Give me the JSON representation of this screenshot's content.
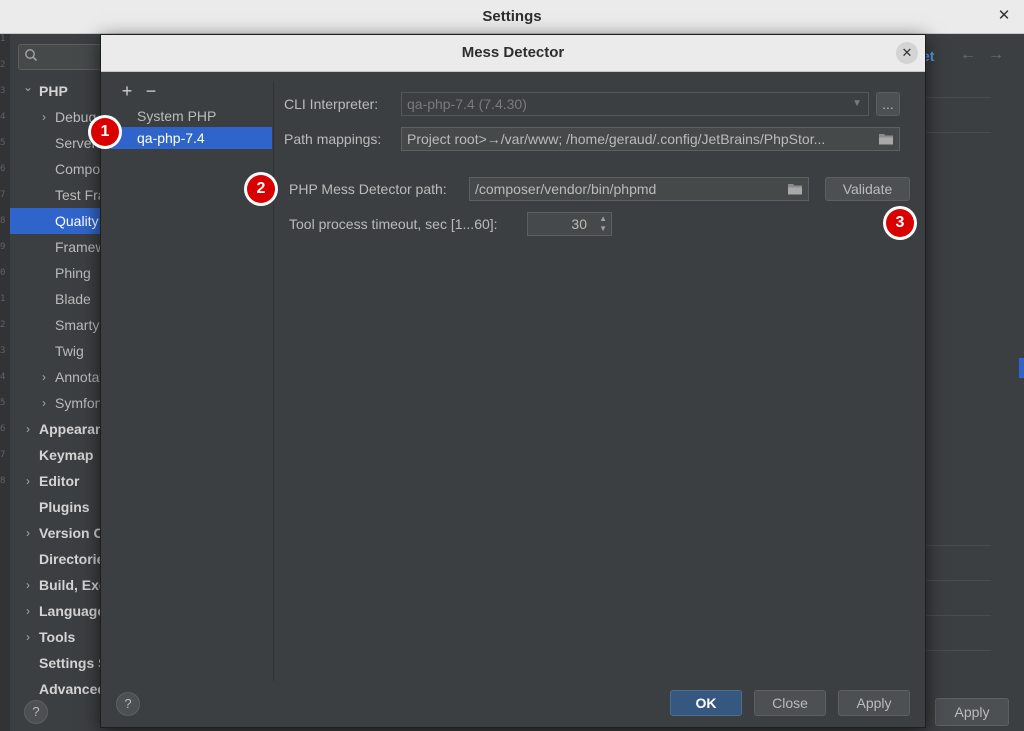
{
  "settings": {
    "title": "Settings",
    "close_icon": "close-icon",
    "search": {
      "value": "",
      "icon": "search-icon"
    },
    "tree": [
      {
        "label": "PHP",
        "level": 0,
        "bold": true,
        "chevron": "down"
      },
      {
        "label": "Debug",
        "level": 1,
        "bold": false,
        "chevron": "right"
      },
      {
        "label": "Servers",
        "level": 1,
        "bold": false,
        "chevron": ""
      },
      {
        "label": "Composer",
        "level": 1,
        "bold": false,
        "chevron": ""
      },
      {
        "label": "Test Frameworks",
        "level": 1,
        "bold": false,
        "chevron": ""
      },
      {
        "label": "Quality Tools",
        "level": 1,
        "bold": false,
        "chevron": "",
        "selected": true
      },
      {
        "label": "Frameworks",
        "level": 1,
        "bold": false,
        "chevron": ""
      },
      {
        "label": "Phing",
        "level": 1,
        "bold": false,
        "chevron": ""
      },
      {
        "label": "Blade",
        "level": 1,
        "bold": false,
        "chevron": ""
      },
      {
        "label": "Smarty",
        "level": 1,
        "bold": false,
        "chevron": ""
      },
      {
        "label": "Twig",
        "level": 1,
        "bold": false,
        "chevron": ""
      },
      {
        "label": "Annotations",
        "level": 1,
        "bold": false,
        "chevron": "right"
      },
      {
        "label": "Symfony",
        "level": 1,
        "bold": false,
        "chevron": "right"
      },
      {
        "label": "Appearance",
        "level": 0,
        "bold": true,
        "chevron": "right"
      },
      {
        "label": "Keymap",
        "level": 0,
        "bold": true,
        "chevron": ""
      },
      {
        "label": "Editor",
        "level": 0,
        "bold": true,
        "chevron": "right"
      },
      {
        "label": "Plugins",
        "level": 0,
        "bold": true,
        "chevron": ""
      },
      {
        "label": "Version Control",
        "level": 0,
        "bold": true,
        "chevron": "right"
      },
      {
        "label": "Directories",
        "level": 0,
        "bold": true,
        "chevron": ""
      },
      {
        "label": "Build, Execution",
        "level": 0,
        "bold": true,
        "chevron": "right"
      },
      {
        "label": "Languages",
        "level": 0,
        "bold": true,
        "chevron": "right"
      },
      {
        "label": "Tools",
        "level": 0,
        "bold": true,
        "chevron": "right"
      },
      {
        "label": "Settings Sync",
        "level": 0,
        "bold": true,
        "chevron": ""
      },
      {
        "label": "Advanced",
        "level": 0,
        "bold": true,
        "chevron": ""
      }
    ],
    "reset_label": "et",
    "apply_label": "Apply",
    "help_label": "?",
    "accent_color": "#2f65ca"
  },
  "dialog": {
    "title": "Mess Detector",
    "add_label": "+",
    "remove_label": "−",
    "interpreters": [
      {
        "label": "System PHP",
        "selected": false
      },
      {
        "label": "qa-php-7.4",
        "selected": true
      }
    ],
    "cli": {
      "label": "CLI Interpreter:",
      "value": "qa-php-7.4 (7.4.30)",
      "more_label": "..."
    },
    "path_mappings": {
      "label": "Path mappings:",
      "value": "Project root>→/var/www; /home/geraud/.config/JetBrains/PhpStor..."
    },
    "md_path": {
      "label": "PHP Mess Detector path:",
      "value": "/composer/vendor/bin/phpmd",
      "validate_label": "Validate"
    },
    "timeout": {
      "label": "Tool process timeout, sec [1...60]:",
      "value": "30"
    },
    "buttons": {
      "ok": "OK",
      "close": "Close",
      "apply": "Apply",
      "help": "?"
    }
  },
  "callouts": [
    "1",
    "2",
    "3"
  ],
  "callout_color": "#d90000"
}
